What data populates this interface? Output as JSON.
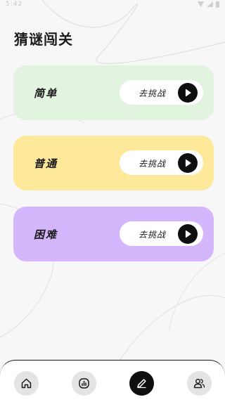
{
  "status_bar": {
    "time": "5:42",
    "extra": "⚙"
  },
  "header": {
    "title": "猜谜闯关"
  },
  "levels": [
    {
      "name": "简单",
      "button_label": "去挑战",
      "color": "#e2f3df"
    },
    {
      "name": "普通",
      "button_label": "去挑战",
      "color": "#fee99b"
    },
    {
      "name": "困难",
      "button_label": "去挑战",
      "color": "#d4b6fd"
    }
  ],
  "tabbar": {
    "items": [
      {
        "icon": "home-icon",
        "active": false
      },
      {
        "icon": "chart-icon",
        "active": false
      },
      {
        "icon": "pencil-icon",
        "active": true
      },
      {
        "icon": "users-icon",
        "active": false
      }
    ]
  },
  "colors": {
    "background": "#f7f7f8",
    "accent_dark": "#0f0f0f"
  }
}
